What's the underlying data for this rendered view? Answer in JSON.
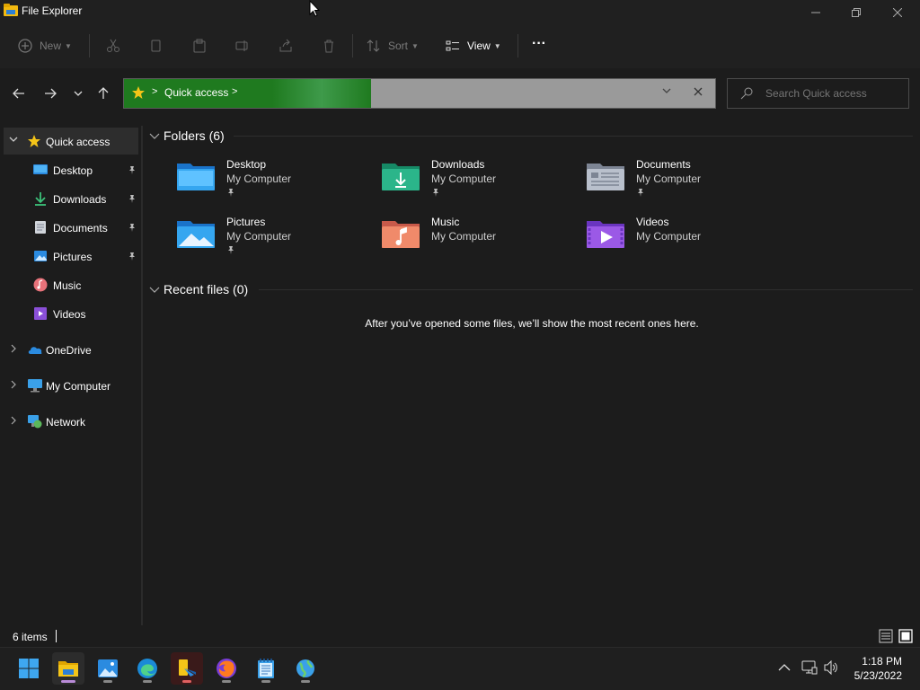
{
  "window": {
    "title": "File Explorer"
  },
  "toolbar": {
    "new_label": "New",
    "sort_label": "Sort",
    "view_label": "View",
    "more_label": "···"
  },
  "address": {
    "location": "Quick access"
  },
  "search": {
    "placeholder": "Search Quick access"
  },
  "sidebar": {
    "quick_access": "Quick access",
    "items": [
      {
        "label": "Desktop",
        "icon": "desktop-icon",
        "pinned": true
      },
      {
        "label": "Downloads",
        "icon": "download-icon",
        "pinned": true
      },
      {
        "label": "Documents",
        "icon": "document-icon",
        "pinned": true
      },
      {
        "label": "Pictures",
        "icon": "pictures-icon",
        "pinned": true
      },
      {
        "label": "Music",
        "icon": "music-icon",
        "pinned": false
      },
      {
        "label": "Videos",
        "icon": "videos-icon",
        "pinned": false
      }
    ],
    "onedrive": "OneDrive",
    "my_computer": "My Computer",
    "network": "Network"
  },
  "content": {
    "folders_header": "Folders (6)",
    "folders": [
      {
        "name": "Desktop",
        "location": "My Computer",
        "pinned": true,
        "icon": "desktop-folder-icon"
      },
      {
        "name": "Downloads",
        "location": "My Computer",
        "pinned": true,
        "icon": "downloads-folder-icon"
      },
      {
        "name": "Documents",
        "location": "My Computer",
        "pinned": true,
        "icon": "documents-folder-icon"
      },
      {
        "name": "Pictures",
        "location": "My Computer",
        "pinned": true,
        "icon": "pictures-folder-icon"
      },
      {
        "name": "Music",
        "location": "My Computer",
        "pinned": false,
        "icon": "music-folder-icon"
      },
      {
        "name": "Videos",
        "location": "My Computer",
        "pinned": false,
        "icon": "videos-folder-icon"
      }
    ],
    "recent_header": "Recent files (0)",
    "recent_empty": "After you’ve opened some files, we’ll show the most recent ones here."
  },
  "status": {
    "item_count": "6 items"
  },
  "taskbar": {
    "time": "1:18 PM",
    "date": "5/23/2022"
  },
  "colors": {
    "accent_green": "#1f7a1f",
    "background": "#1c1c1c",
    "toolbar": "#202020"
  }
}
